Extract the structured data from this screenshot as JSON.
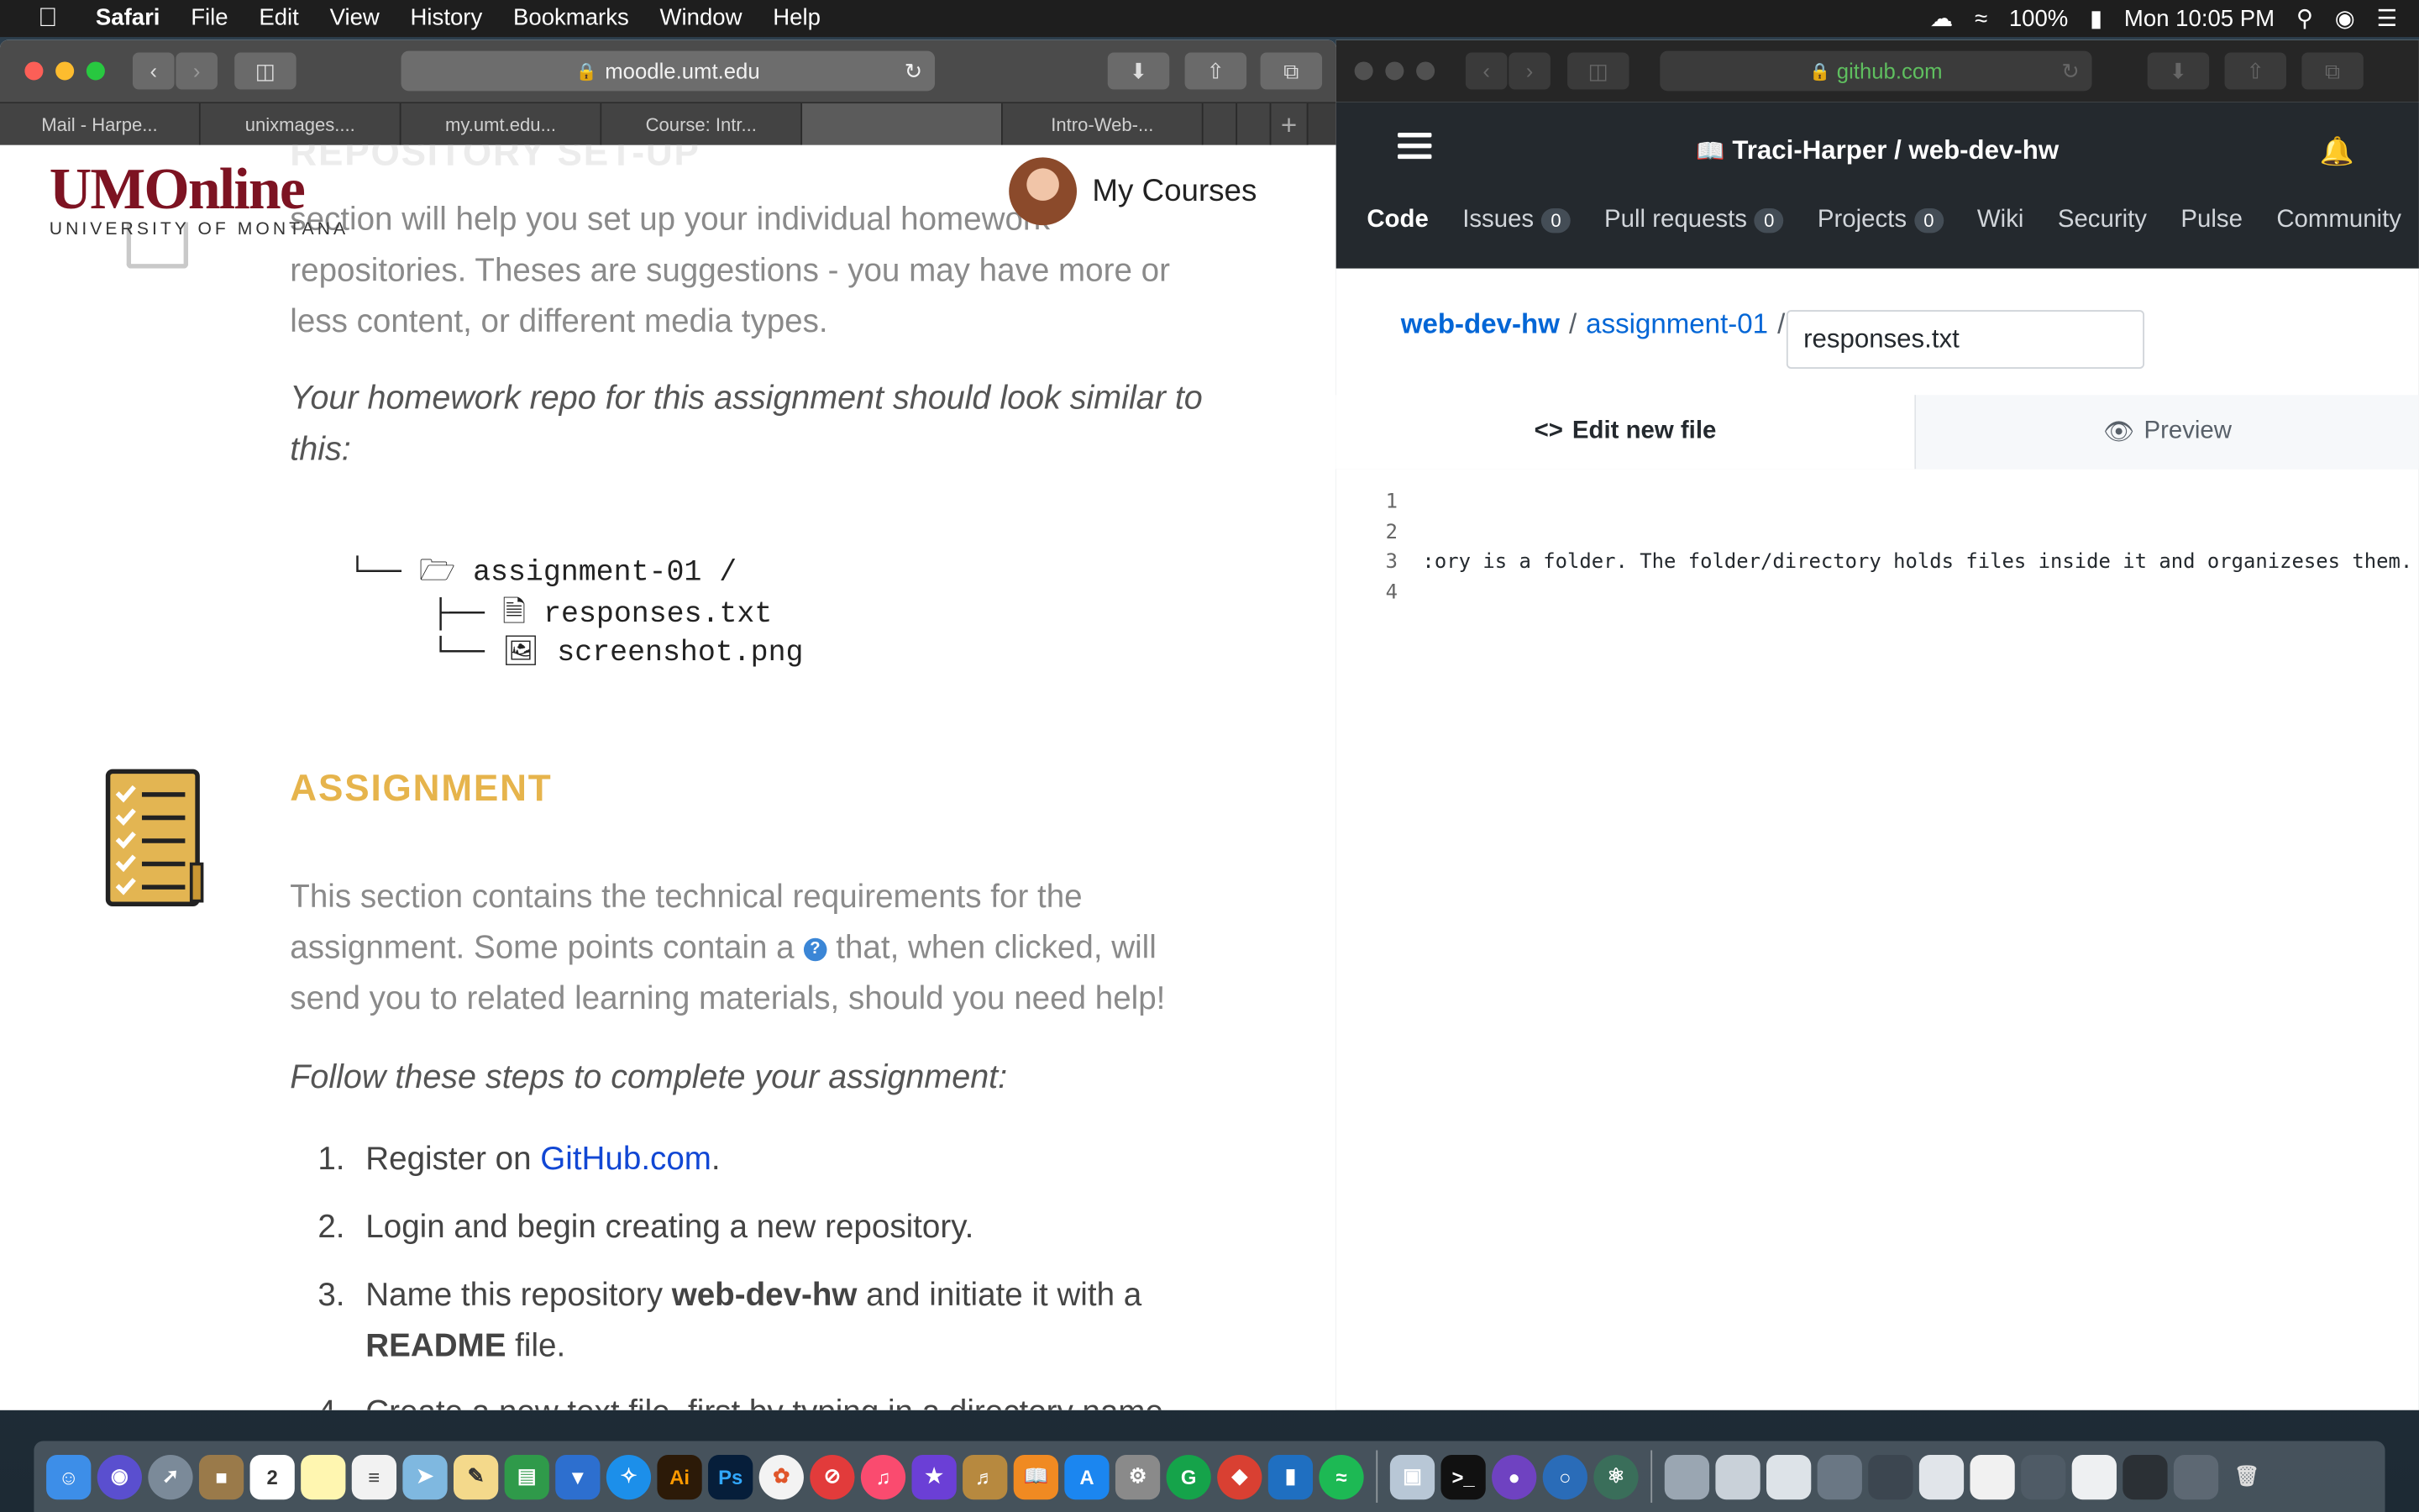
{
  "menubar": {
    "app": "Safari",
    "items": [
      "File",
      "Edit",
      "View",
      "History",
      "Bookmarks",
      "Window",
      "Help"
    ],
    "battery": "100%",
    "clock": "Mon 10:05 PM"
  },
  "left_window": {
    "url": "moodle.umt.edu",
    "tabs": [
      "Mail - Harpe...",
      "unixmages....",
      "my.umt.edu...",
      "Course: Intr...",
      "",
      "Intro-Web-..."
    ],
    "logo_main": "UMOnline",
    "logo_sub": "UNIVERSITY OF MONTANA",
    "my_courses": "My Courses",
    "faded_heading": "REPOSITORY SET-UP",
    "intro_line1": "section will help you set up your individual homework",
    "intro_line2": "repositories. Theses are suggestions - you may have more or",
    "intro_line3": "less content, or different media types.",
    "repo_note": "Your homework repo for this assignment should look similar to this:",
    "tree": {
      "folder": "assignment-01 /",
      "file1": "responses.txt",
      "file2": "screenshot.png"
    },
    "assignment_heading": "ASSIGNMENT",
    "assignment_p1": "This section contains the technical requirements for the",
    "assignment_p2a": "assignment. Some points contain a",
    "assignment_p2b": "that, when clicked, will",
    "assignment_p3": "send you to related learning materials, should you need help!",
    "steps_intro": "Follow these steps to complete your assignment:",
    "steps": {
      "s1_num": "1.",
      "s1_pre": "Register on ",
      "s1_link": "GitHub.com",
      "s1_post": ".",
      "s2_num": "2.",
      "s2": "Login and begin creating a new repository.",
      "s3_num": "3.",
      "s3_pre": "Name this repository ",
      "s3_b1": "web-dev-hw",
      "s3_mid": " and initiate it with a",
      "s3_b2": "README",
      "s3_post": " file.",
      "s4_num": "4.",
      "s4": "Create a new text file, first by typing in a directory name"
    }
  },
  "right_window": {
    "url": "github.com",
    "repo_owner": "Traci-Harper",
    "repo_sep": " / ",
    "repo_name": "web-dev-hw",
    "nav": {
      "code": "Code",
      "issues": "Issues",
      "issues_count": "0",
      "pulls": "Pull requests",
      "pulls_count": "0",
      "projects": "Projects",
      "projects_count": "0",
      "wiki": "Wiki",
      "security": "Security",
      "pulse": "Pulse",
      "community": "Community"
    },
    "breadcrumb_repo": "web-dev-hw",
    "breadcrumb_dir": "assignment-01",
    "breadcrumb_sep": "/",
    "filename": "responses.txt",
    "tab_edit": "Edit new file",
    "tab_preview": "Preview",
    "line_numbers": [
      "1",
      "2",
      "3",
      "4"
    ],
    "line3": ":ory is a folder. The folder/directory holds files inside it and organizeses them."
  }
}
